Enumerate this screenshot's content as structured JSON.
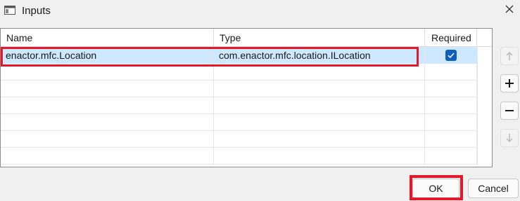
{
  "window": {
    "title": "Inputs",
    "icon": "window-icon",
    "close_icon": "close-icon"
  },
  "table": {
    "columns": [
      "Name",
      "Type",
      "Required"
    ],
    "rows": [
      {
        "name": "enactor.mfc.Location",
        "type": "com.enactor.mfc.location.ILocation",
        "required": true,
        "selected": true
      }
    ],
    "empty_row_count": 6
  },
  "side_buttons": [
    {
      "icon": "arrow-up-icon",
      "enabled": false
    },
    {
      "icon": "plus-icon",
      "enabled": true
    },
    {
      "icon": "minus-icon",
      "enabled": true
    },
    {
      "icon": "arrow-down-icon",
      "enabled": false
    }
  ],
  "buttons": {
    "ok": "OK",
    "cancel": "Cancel"
  },
  "colors": {
    "selection": "#cde8ff",
    "highlight": "#e2192c",
    "checkbox": "#0f5fbf"
  }
}
